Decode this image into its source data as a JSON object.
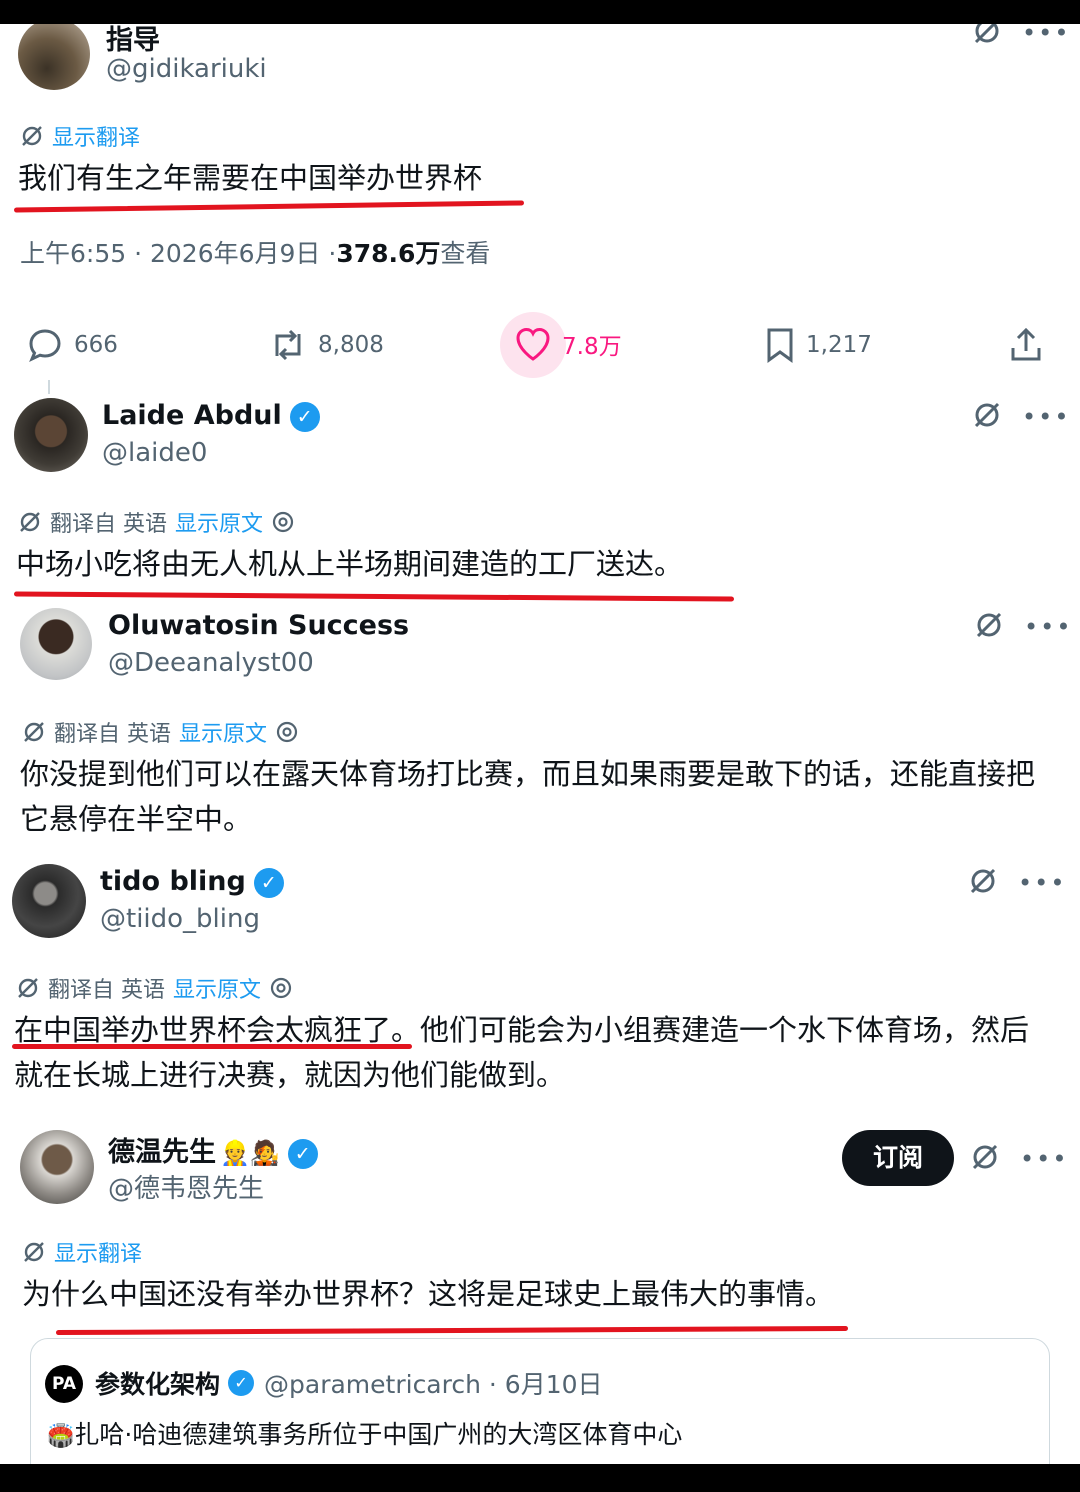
{
  "tweet1": {
    "name": "指导",
    "handle": "@gidikariuki",
    "translate_label": "显示翻译",
    "text": "我们有生之年需要在中国举办世界杯",
    "time": "上午6:55 · 2026年6月9日 · ",
    "views": "378.6万",
    "views_label": " 查看",
    "replies": "666",
    "retweets": "8,808",
    "likes": "7.8万",
    "bookmarks": "1,217"
  },
  "reply1": {
    "name": "Laide Abdul",
    "handle": "@laide0",
    "translated_from": "翻译自 英语",
    "show_original": "显示原文",
    "text": "中场小吃将由无人机从上半场期间建造的工厂送达。"
  },
  "reply2": {
    "name": "Oluwatosin Success",
    "handle": "@Deeanalyst00",
    "translated_from": "翻译自 英语",
    "show_original": "显示原文",
    "text": "你没提到他们可以在露天体育场打比赛，而且如果雨要是敢下的话，还能直接把它悬停在半空中。"
  },
  "reply3": {
    "name": "tido bling",
    "handle": "@tiido_bling",
    "translated_from": "翻译自 英语",
    "show_original": "显示原文",
    "text": "在中国举办世界杯会太疯狂了。他们可能会为小组赛建造一个水下体育场，然后就在长城上进行决赛，就因为他们能做到。"
  },
  "reply4": {
    "name": "德温先生",
    "emoji": "👷🧑‍🎤",
    "handle": "@德韦恩先生",
    "subscribe": "订阅",
    "translate_label": "显示翻译",
    "text": "为什么中国还没有举办世界杯？这将是足球史上最伟大的事情。"
  },
  "quote": {
    "avatar_text": "PA",
    "name": "参数化架构",
    "handle": "@parametricarch · 6月10日",
    "emoji": "🏟️",
    "text": "扎哈·哈迪德建筑事务所位于中国广州的大湾区体育中心"
  },
  "colors": {
    "accent": "#1d9bf0",
    "underline": "#e2141f",
    "like": "#f91880"
  }
}
